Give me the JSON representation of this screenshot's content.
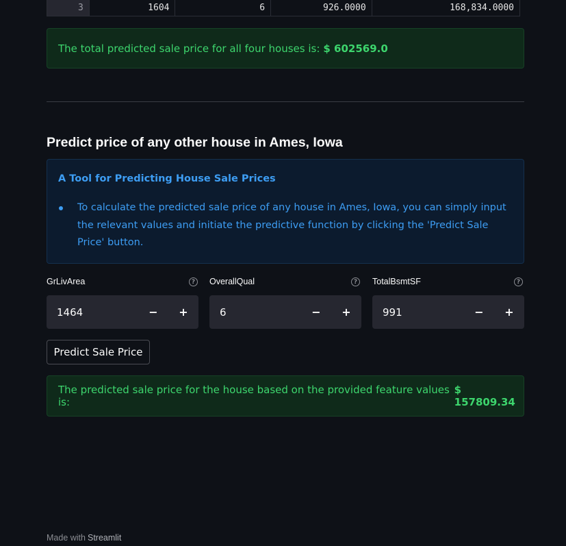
{
  "table_row": {
    "index": "3",
    "GrLivArea": "1604",
    "OverallQual": "6",
    "TotalBsmtSF": "926.0000",
    "SalePrice": "168,834.0000"
  },
  "total_message": {
    "text": "The total predicted sale price for all four houses is:",
    "value": "$ 602569.0"
  },
  "section_heading": "Predict price of any other house in Ames, Iowa",
  "info_box": {
    "title": "A Tool for Predicting House Sale Prices",
    "bullet": "To calculate the predicted sale price of any house in Ames, Iowa, you can simply input the relevant values and initiate the predictive function by clicking the 'Predict Sale Price' button."
  },
  "inputs": [
    {
      "label": "GrLivArea",
      "value": "1464"
    },
    {
      "label": "OverallQual",
      "value": "6"
    },
    {
      "label": "TotalBsmtSF",
      "value": "991"
    }
  ],
  "stepper": {
    "minus": "−",
    "plus": "+"
  },
  "help_glyph": "?",
  "predict_button": "Predict Sale Price",
  "prediction_message": {
    "text": "The predicted sale price for the house based on the provided feature values is:",
    "value": "$ 157809.34"
  },
  "footer": {
    "prefix": "Made with",
    "brand": "Streamlit"
  },
  "colors": {
    "background": "#0e1117",
    "success_text": "#3dd56d",
    "info_text": "#3d9df3",
    "input_bg": "#262730"
  }
}
